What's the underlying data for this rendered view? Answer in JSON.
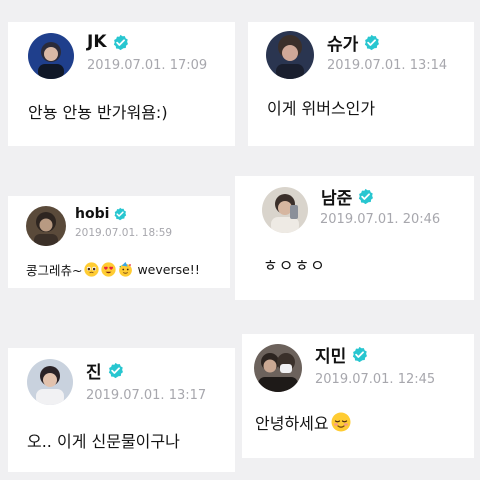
{
  "theme": {
    "accent": "#28c6d0",
    "date_color": "#a7a7ad",
    "background": "#f0f0f2"
  },
  "posts": [
    {
      "author": "JK",
      "verified": true,
      "date": "2019.07.01. 17:09",
      "text": "안뇽 안뇽 반가워욤:)"
    },
    {
      "author": "슈가",
      "verified": true,
      "date": "2019.07.01. 13:14",
      "text": "이게 위버스인가"
    },
    {
      "author": "hobi",
      "verified": true,
      "date": "2019.07.01. 18:59",
      "text": "콩그레츄~",
      "emojis": [
        "pleading-face-emoji",
        "heart-eyes-emoji",
        "party-face-emoji"
      ],
      "text_after": " weverse!!"
    },
    {
      "author": "남준",
      "verified": true,
      "date": "2019.07.01. 20:46",
      "text": "ㅎㅇㅎㅇ"
    },
    {
      "author": "진",
      "verified": true,
      "date": "2019.07.01. 13:17",
      "text": "오.. 이게 신문물이구나"
    },
    {
      "author": "지민",
      "verified": true,
      "date": "2019.07.01. 12:45",
      "text": "안녕하세요",
      "emojis": [
        "relieved-face-emoji"
      ]
    }
  ]
}
